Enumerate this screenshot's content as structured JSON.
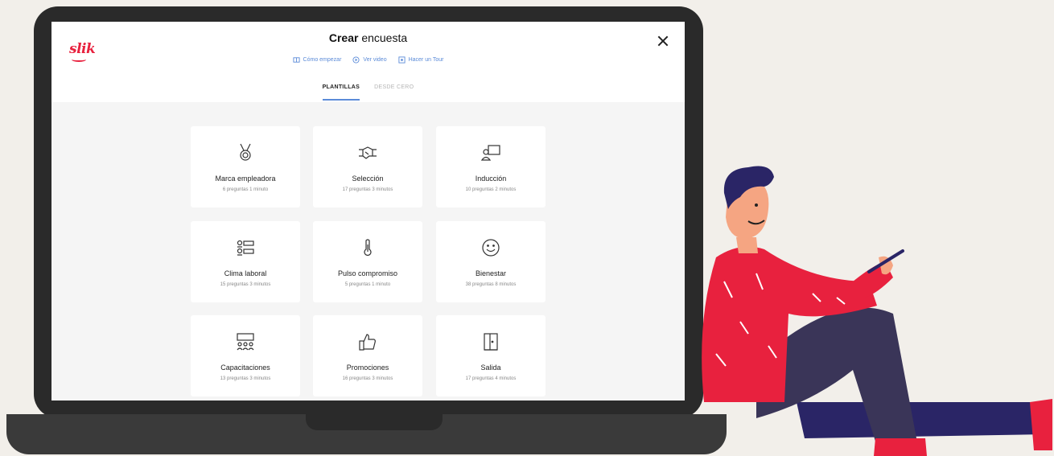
{
  "app": {
    "logo": "slik",
    "title_bold": "Crear",
    "title_rest": " encuesta"
  },
  "help_links": [
    {
      "label": "Cómo empezar",
      "icon": "book-icon"
    },
    {
      "label": "Ver video",
      "icon": "play-icon"
    },
    {
      "label": "Hacer un Tour",
      "icon": "tour-icon"
    }
  ],
  "tabs": [
    {
      "label": "PLANTILLAS",
      "active": true
    },
    {
      "label": "DESDE CERO",
      "active": false
    }
  ],
  "templates": [
    {
      "title": "Marca empleadora",
      "meta": "6 preguntas 1 minuto",
      "icon": "medal-icon"
    },
    {
      "title": "Selección",
      "meta": "17 preguntas 3 minutos",
      "icon": "handshake-icon"
    },
    {
      "title": "Inducción",
      "meta": "10 preguntas 2 minutos",
      "icon": "presentation-icon"
    },
    {
      "title": "Clima laboral",
      "meta": "15 preguntas 3 minutos",
      "icon": "team-icon"
    },
    {
      "title": "Pulso compromiso",
      "meta": "5 preguntas 1 minuto",
      "icon": "thermometer-icon"
    },
    {
      "title": "Bienestar",
      "meta": "38 preguntas 8 minutos",
      "icon": "smile-icon"
    },
    {
      "title": "Capacitaciones",
      "meta": "13 preguntas 3 minutos",
      "icon": "audience-icon"
    },
    {
      "title": "Promociones",
      "meta": "16 preguntas 3 minutos",
      "icon": "thumbs-up-icon"
    },
    {
      "title": "Salida",
      "meta": "17 preguntas 4 minutos",
      "icon": "exit-door-icon"
    }
  ],
  "colors": {
    "brand": "#e8213e",
    "accent": "#5b8bd8",
    "background": "#f2efea"
  }
}
